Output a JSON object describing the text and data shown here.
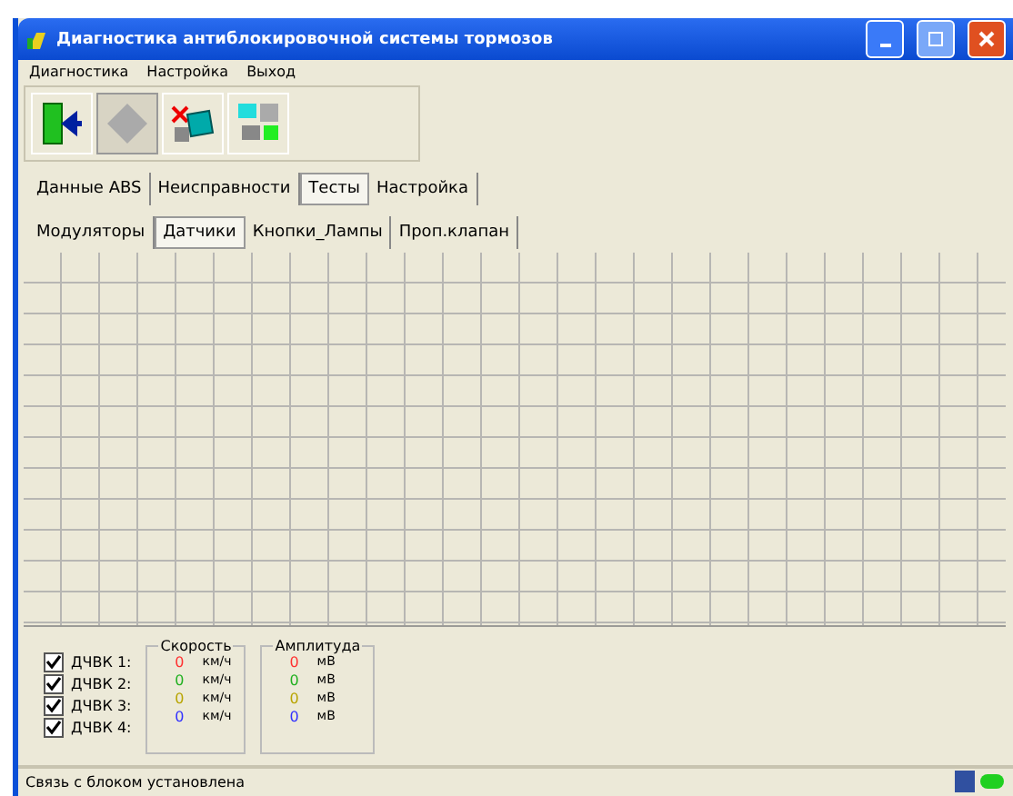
{
  "window": {
    "title": "Диагностика антиблокировочной системы тормозов"
  },
  "menu": [
    "Диагностика",
    "Настройка",
    "Выход"
  ],
  "toolbar": [
    {
      "kind": "exit",
      "disabled": false
    },
    {
      "kind": "diamond",
      "disabled": true
    },
    {
      "kind": "disconnect",
      "disabled": false
    },
    {
      "kind": "network",
      "disabled": false
    }
  ],
  "tabs": [
    {
      "label": "Данные ABS",
      "selected": false
    },
    {
      "label": "Неисправности",
      "selected": false
    },
    {
      "label": "Тесты",
      "selected": true
    },
    {
      "label": "Настройка",
      "selected": false
    }
  ],
  "subtabs": [
    {
      "label": "Модуляторы",
      "selected": false
    },
    {
      "label": "Датчики",
      "selected": true
    },
    {
      "label": "Кнопки_Лампы",
      "selected": false
    },
    {
      "label": "Проп.клапан",
      "selected": false
    }
  ],
  "speed_group": {
    "title": "Скорость"
  },
  "amplitude_group": {
    "title": "Амплитуда"
  },
  "sensors": [
    {
      "label": "ДЧВК 1:",
      "checked": true,
      "color": "#ff3030",
      "speed": "0",
      "speed_unit": "км/ч",
      "amplitude": "0",
      "amplitude_unit": "мВ"
    },
    {
      "label": "ДЧВК 2:",
      "checked": true,
      "color": "#20b020",
      "speed": "0",
      "speed_unit": "км/ч",
      "amplitude": "0",
      "amplitude_unit": "мВ"
    },
    {
      "label": "ДЧВК 3:",
      "checked": true,
      "color": "#b8a400",
      "speed": "0",
      "speed_unit": "км/ч",
      "amplitude": "0",
      "amplitude_unit": "мВ"
    },
    {
      "label": "ДЧВК 4:",
      "checked": true,
      "color": "#3030ff",
      "speed": "0",
      "speed_unit": "км/ч",
      "amplitude": "0",
      "amplitude_unit": "мВ"
    }
  ],
  "status_bar": {
    "text": "Связь с блоком установлена"
  }
}
